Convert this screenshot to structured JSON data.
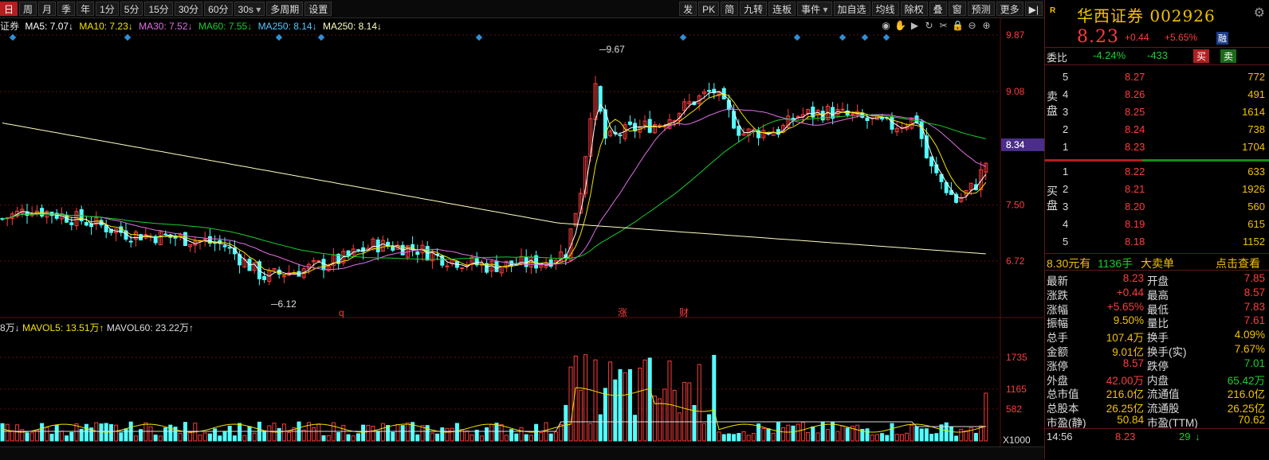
{
  "toolbar": {
    "periods": [
      "日",
      "周",
      "月",
      "季",
      "年",
      "1分",
      "5分",
      "15分",
      "30分",
      "60分",
      "30s"
    ],
    "active_period": "日",
    "multi": "多周期",
    "settings": "设置",
    "right_tools": [
      "发",
      "PK",
      "简",
      "九转",
      "连板",
      "事件",
      "加自选",
      "均线",
      "除权",
      "叠",
      "窗",
      "预测",
      "更多"
    ]
  },
  "ma_legend": {
    "name": "证券",
    "ma5": "MA5: 7.07↓",
    "ma10": "MA10: 7.23↓",
    "ma30": "MA30: 7.52↓",
    "ma60": "MA60: 7.55↓",
    "ma250a": "MA250: 8.14↓",
    "ma250b": "MA250: 8.14↓"
  },
  "price_axis": {
    "labels": [
      "9.87",
      "9.08",
      "8.34",
      "7.50",
      "6.72"
    ]
  },
  "annotations": {
    "high": "9.67",
    "low": "6.12",
    "marks": [
      "q",
      "涨",
      "财"
    ]
  },
  "volume_legend": {
    "vol": "8万↓",
    "mavol5": "MAVOL5: 13.51万↑",
    "mavol60": "MAVOL60: 23.22万↑"
  },
  "volume_axis": {
    "labels": [
      "1735",
      "1165",
      "582"
    ],
    "unit": "X1000"
  },
  "colors": {
    "up": "#ff3c3c",
    "down": "#54ffff",
    "ma5": "#ffffff",
    "ma10": "#f3e300",
    "ma30": "#e26fe6",
    "ma60": "#1ccf2c",
    "ma250": "#ffffc0"
  },
  "stock": {
    "name": "华西证券",
    "code": "002926",
    "price": "8.23",
    "change": "+0.44",
    "pct": "+5.65%",
    "tag": "融"
  },
  "weibi": {
    "label": "委比",
    "pct": "-4.24%",
    "diff": "-433",
    "buy": "买",
    "sell": "卖"
  },
  "ask": {
    "side": "卖盘",
    "rows": [
      {
        "lvl": "5",
        "price": "8.27",
        "vol": "772"
      },
      {
        "lvl": "4",
        "price": "8.26",
        "vol": "491"
      },
      {
        "lvl": "3",
        "price": "8.25",
        "vol": "1614"
      },
      {
        "lvl": "2",
        "price": "8.24",
        "vol": "738"
      },
      {
        "lvl": "1",
        "price": "8.23",
        "vol": "1704"
      }
    ]
  },
  "bid": {
    "side": "买盘",
    "rows": [
      {
        "lvl": "1",
        "price": "8.22",
        "vol": "633"
      },
      {
        "lvl": "2",
        "price": "8.21",
        "vol": "1926"
      },
      {
        "lvl": "3",
        "price": "8.20",
        "vol": "560"
      },
      {
        "lvl": "4",
        "price": "8.19",
        "vol": "615"
      },
      {
        "lvl": "5",
        "price": "8.18",
        "vol": "1152"
      }
    ]
  },
  "bigorder": {
    "a": "8.30元有",
    "b": "1136手",
    "c": "大卖单",
    "d": "点击查看"
  },
  "stats": [
    {
      "k1": "最新",
      "v1": "8.23",
      "c1": "#ff3c3c",
      "k2": "开盘",
      "v2": "7.85",
      "c2": "#ff3c3c"
    },
    {
      "k1": "涨跌",
      "v1": "+0.44",
      "c1": "#ff3c3c",
      "k2": "最高",
      "v2": "8.57",
      "c2": "#ff3c3c"
    },
    {
      "k1": "涨幅",
      "v1": "+5.65%",
      "c1": "#ff3c3c",
      "k2": "最低",
      "v2": "7.83",
      "c2": "#ff3c3c"
    },
    {
      "k1": "振幅",
      "v1": "9.50%",
      "c1": "#f3c200",
      "k2": "量比",
      "v2": "7.61",
      "c2": "#ff3c3c"
    },
    {
      "k1": "总手",
      "v1": "107.4万",
      "c1": "#f3c200",
      "k2": "换手",
      "v2": "4.09%",
      "c2": "#f3c200"
    },
    {
      "k1": "金额",
      "v1": "9.01亿",
      "c1": "#f3c200",
      "k2": "换手(实)",
      "v2": "7.67%",
      "c2": "#f3c200"
    },
    {
      "k1": "涨停",
      "v1": "8.57",
      "c1": "#ff3c3c",
      "k2": "跌停",
      "v2": "7.01",
      "c2": "#1ccf2c"
    },
    {
      "k1": "外盘",
      "v1": "42.00万",
      "c1": "#ff3c3c",
      "k2": "内盘",
      "v2": "65.42万",
      "c2": "#1ccf2c"
    },
    {
      "k1": "总市值",
      "v1": "216.0亿",
      "c1": "#f3c200",
      "k2": "流通值",
      "v2": "216.0亿",
      "c2": "#f3c200"
    },
    {
      "k1": "总股本",
      "v1": "26.25亿",
      "c1": "#f3c200",
      "k2": "流通股",
      "v2": "26.25亿",
      "c2": "#f3c200"
    },
    {
      "k1": "市盈(静)",
      "v1": "50.84",
      "c1": "#f3c200",
      "k2": "市盈(TTM)",
      "v2": "70.62",
      "c2": "#f3c200"
    }
  ],
  "last_tick": {
    "time": "14:56",
    "price": "8.23",
    "vol": "29",
    "dir": "↓"
  }
}
